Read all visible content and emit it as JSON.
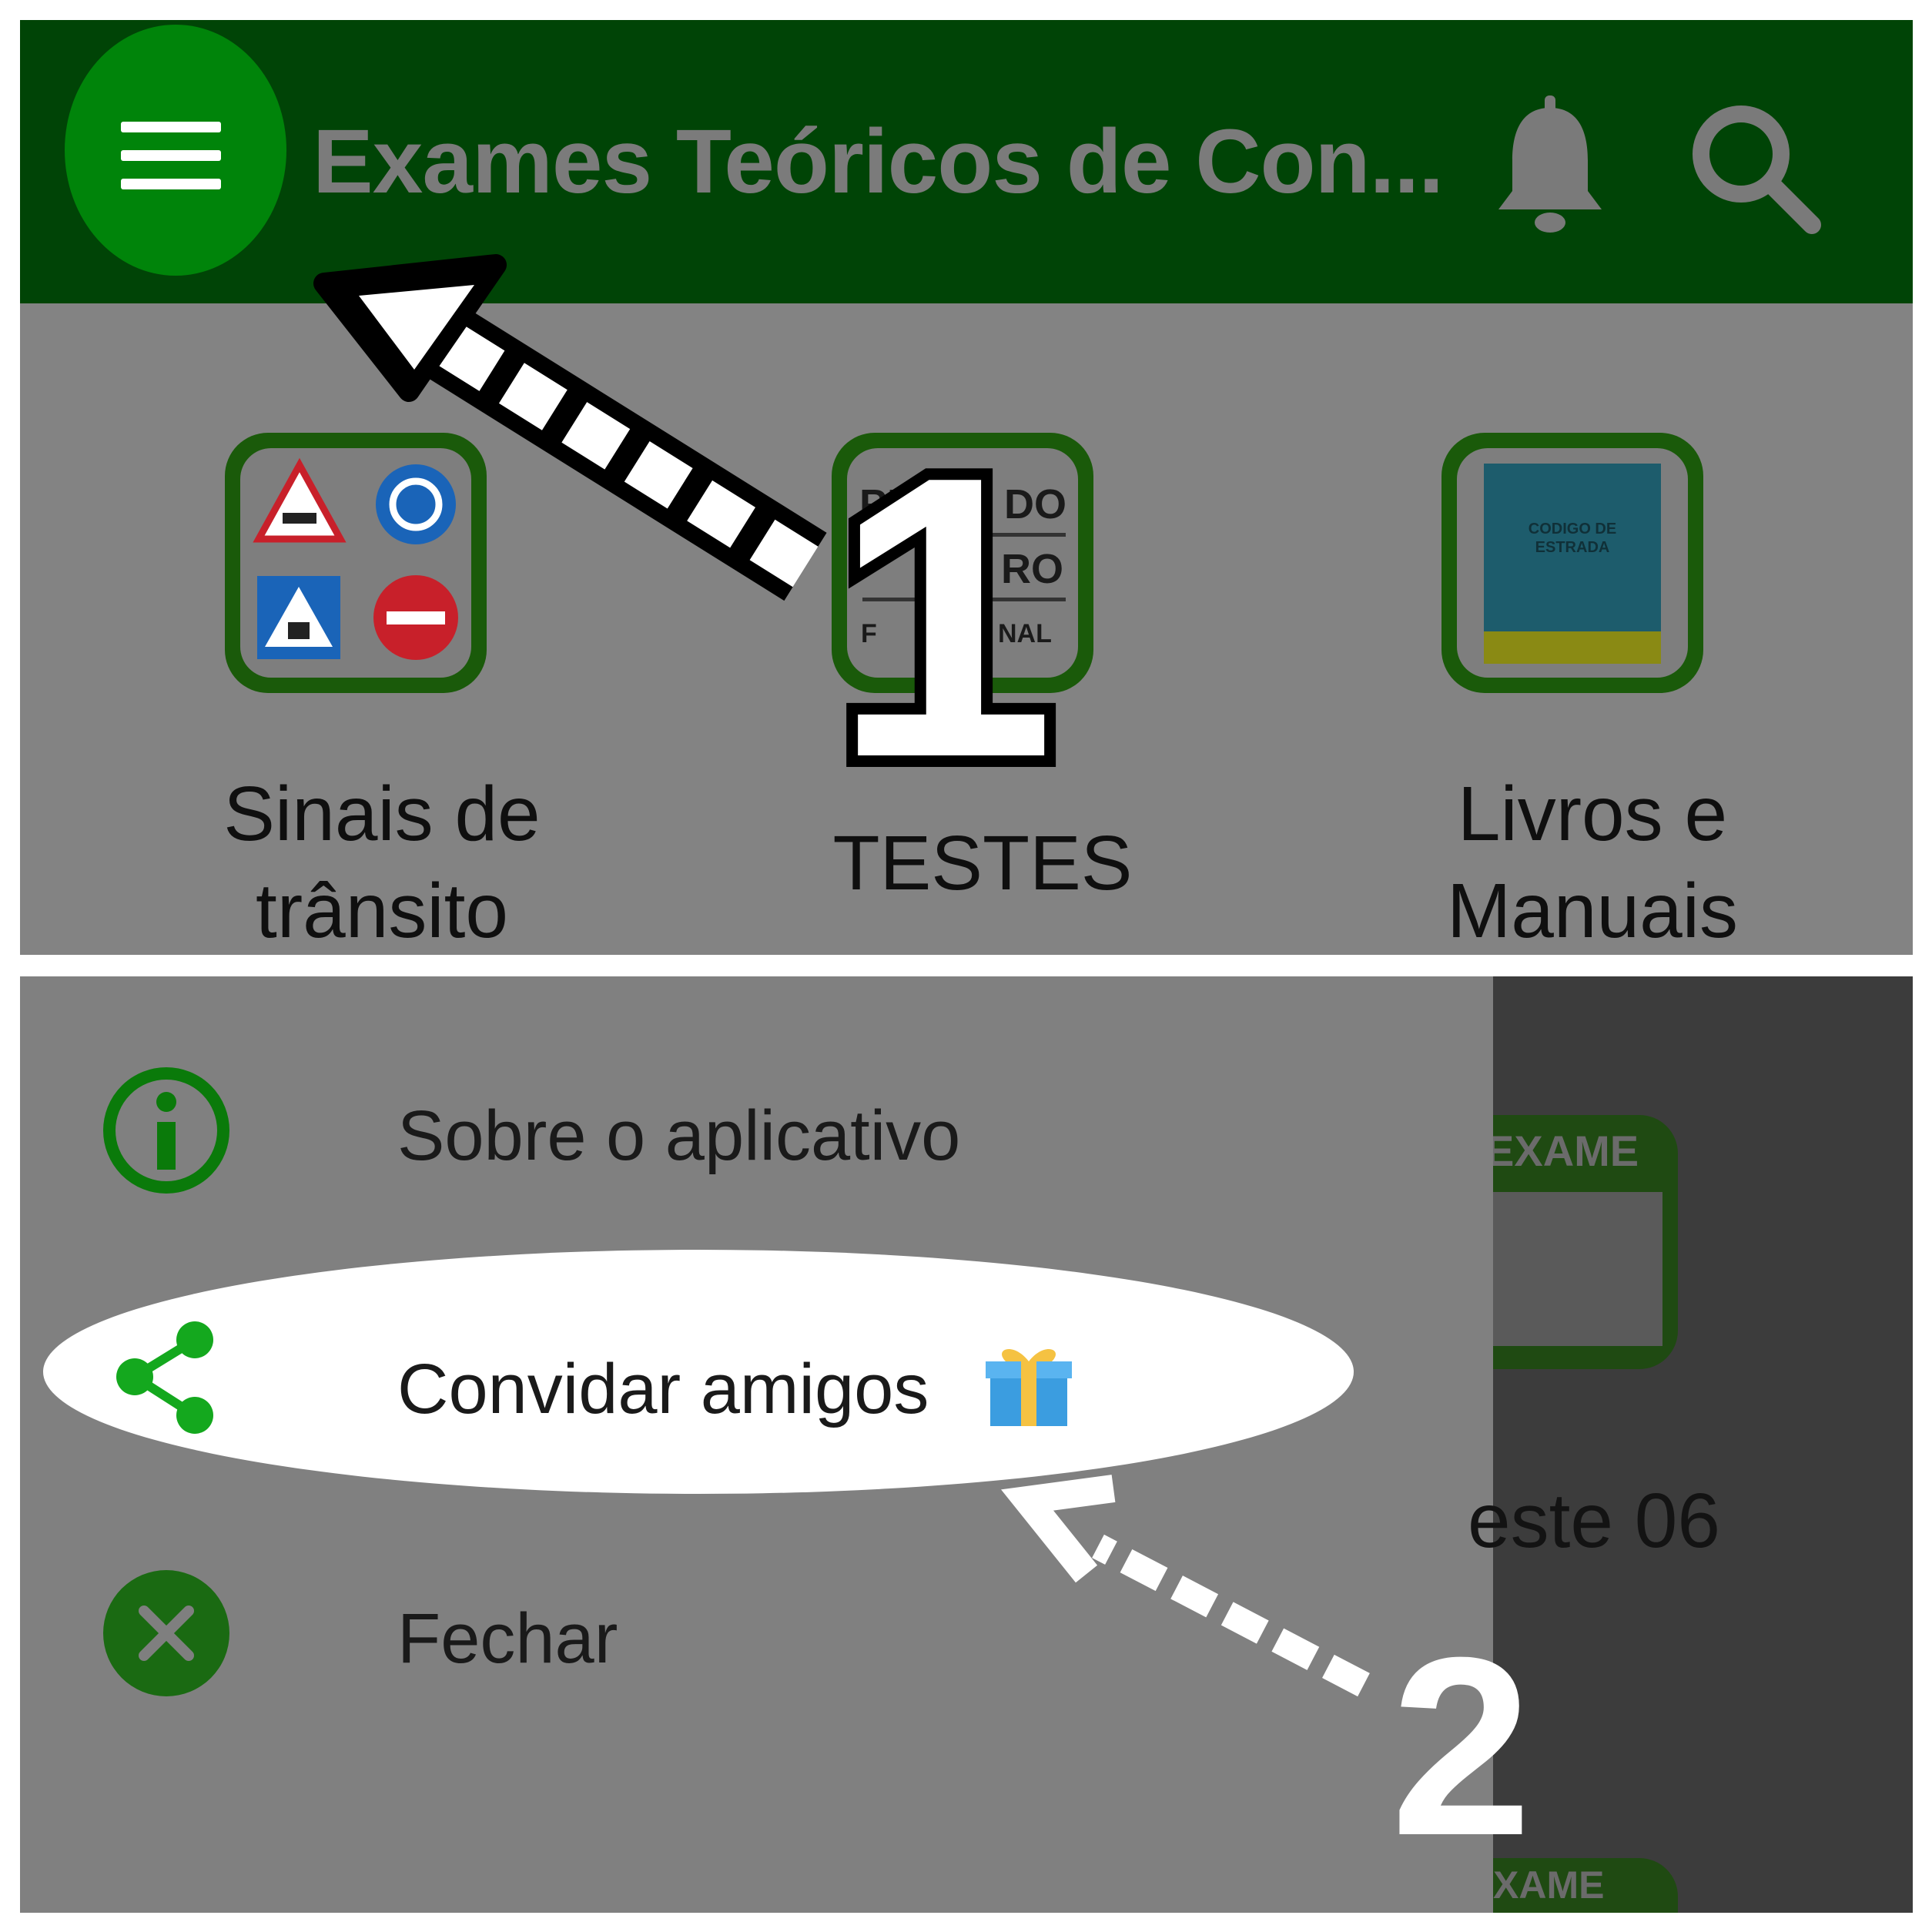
{
  "app_bar": {
    "title": "Exames Teóricos de Con...",
    "colors": {
      "bar": "#004406",
      "menu_highlight": "#00840a",
      "title": "#7b7b7b"
    }
  },
  "categories": [
    {
      "label_line1": "Sinais de",
      "label_line2": "trânsito",
      "icon": "traffic-signs-icon"
    },
    {
      "label_line1": "TESTES",
      "label_line2": "",
      "icon": "tests-icon",
      "icon_text": [
        "PE",
        "DO",
        "RO",
        "F",
        "NAL"
      ]
    },
    {
      "label_line1": "Livros e",
      "label_line2": "Manuais",
      "icon": "book-icon",
      "icon_text": [
        "CODIGO DE",
        "ESTRADA"
      ]
    }
  ],
  "annotations": {
    "step1": "1",
    "step2": "2"
  },
  "drawer": {
    "items": [
      {
        "label": "Sobre o aplicativo",
        "icon": "info-icon"
      },
      {
        "label": "Convidar amigos",
        "icon": "share-icon",
        "badge": "gift-icon",
        "highlighted": true
      },
      {
        "label": "Fechar",
        "icon": "close-icon"
      }
    ]
  },
  "background_content": {
    "card_banner": "EXAME",
    "card_label": "este 06",
    "card_banner_2": "XAME"
  }
}
